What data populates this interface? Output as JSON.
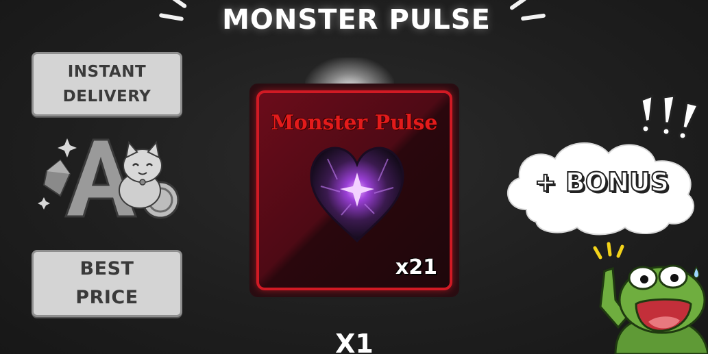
{
  "title": "MONSTER PULSE",
  "badges": {
    "delivery": {
      "line1": "INSTANT",
      "line2": "DELIVERY"
    },
    "price": {
      "line1": "BEST",
      "line2": "PRICE"
    }
  },
  "product_card": {
    "name": "Monster Pulse",
    "quantity": "x21",
    "icon": "dark-heart-icon",
    "border_color": "#d11a24",
    "name_color": "#e21b1b"
  },
  "bonus": {
    "label": "+ BONUS",
    "exclamations": "!!!"
  },
  "purchase_count": "X1",
  "colors": {
    "background": "#1e1e1e",
    "badge_fill": "#d4d4d4",
    "badge_text": "#3a3a3a"
  }
}
